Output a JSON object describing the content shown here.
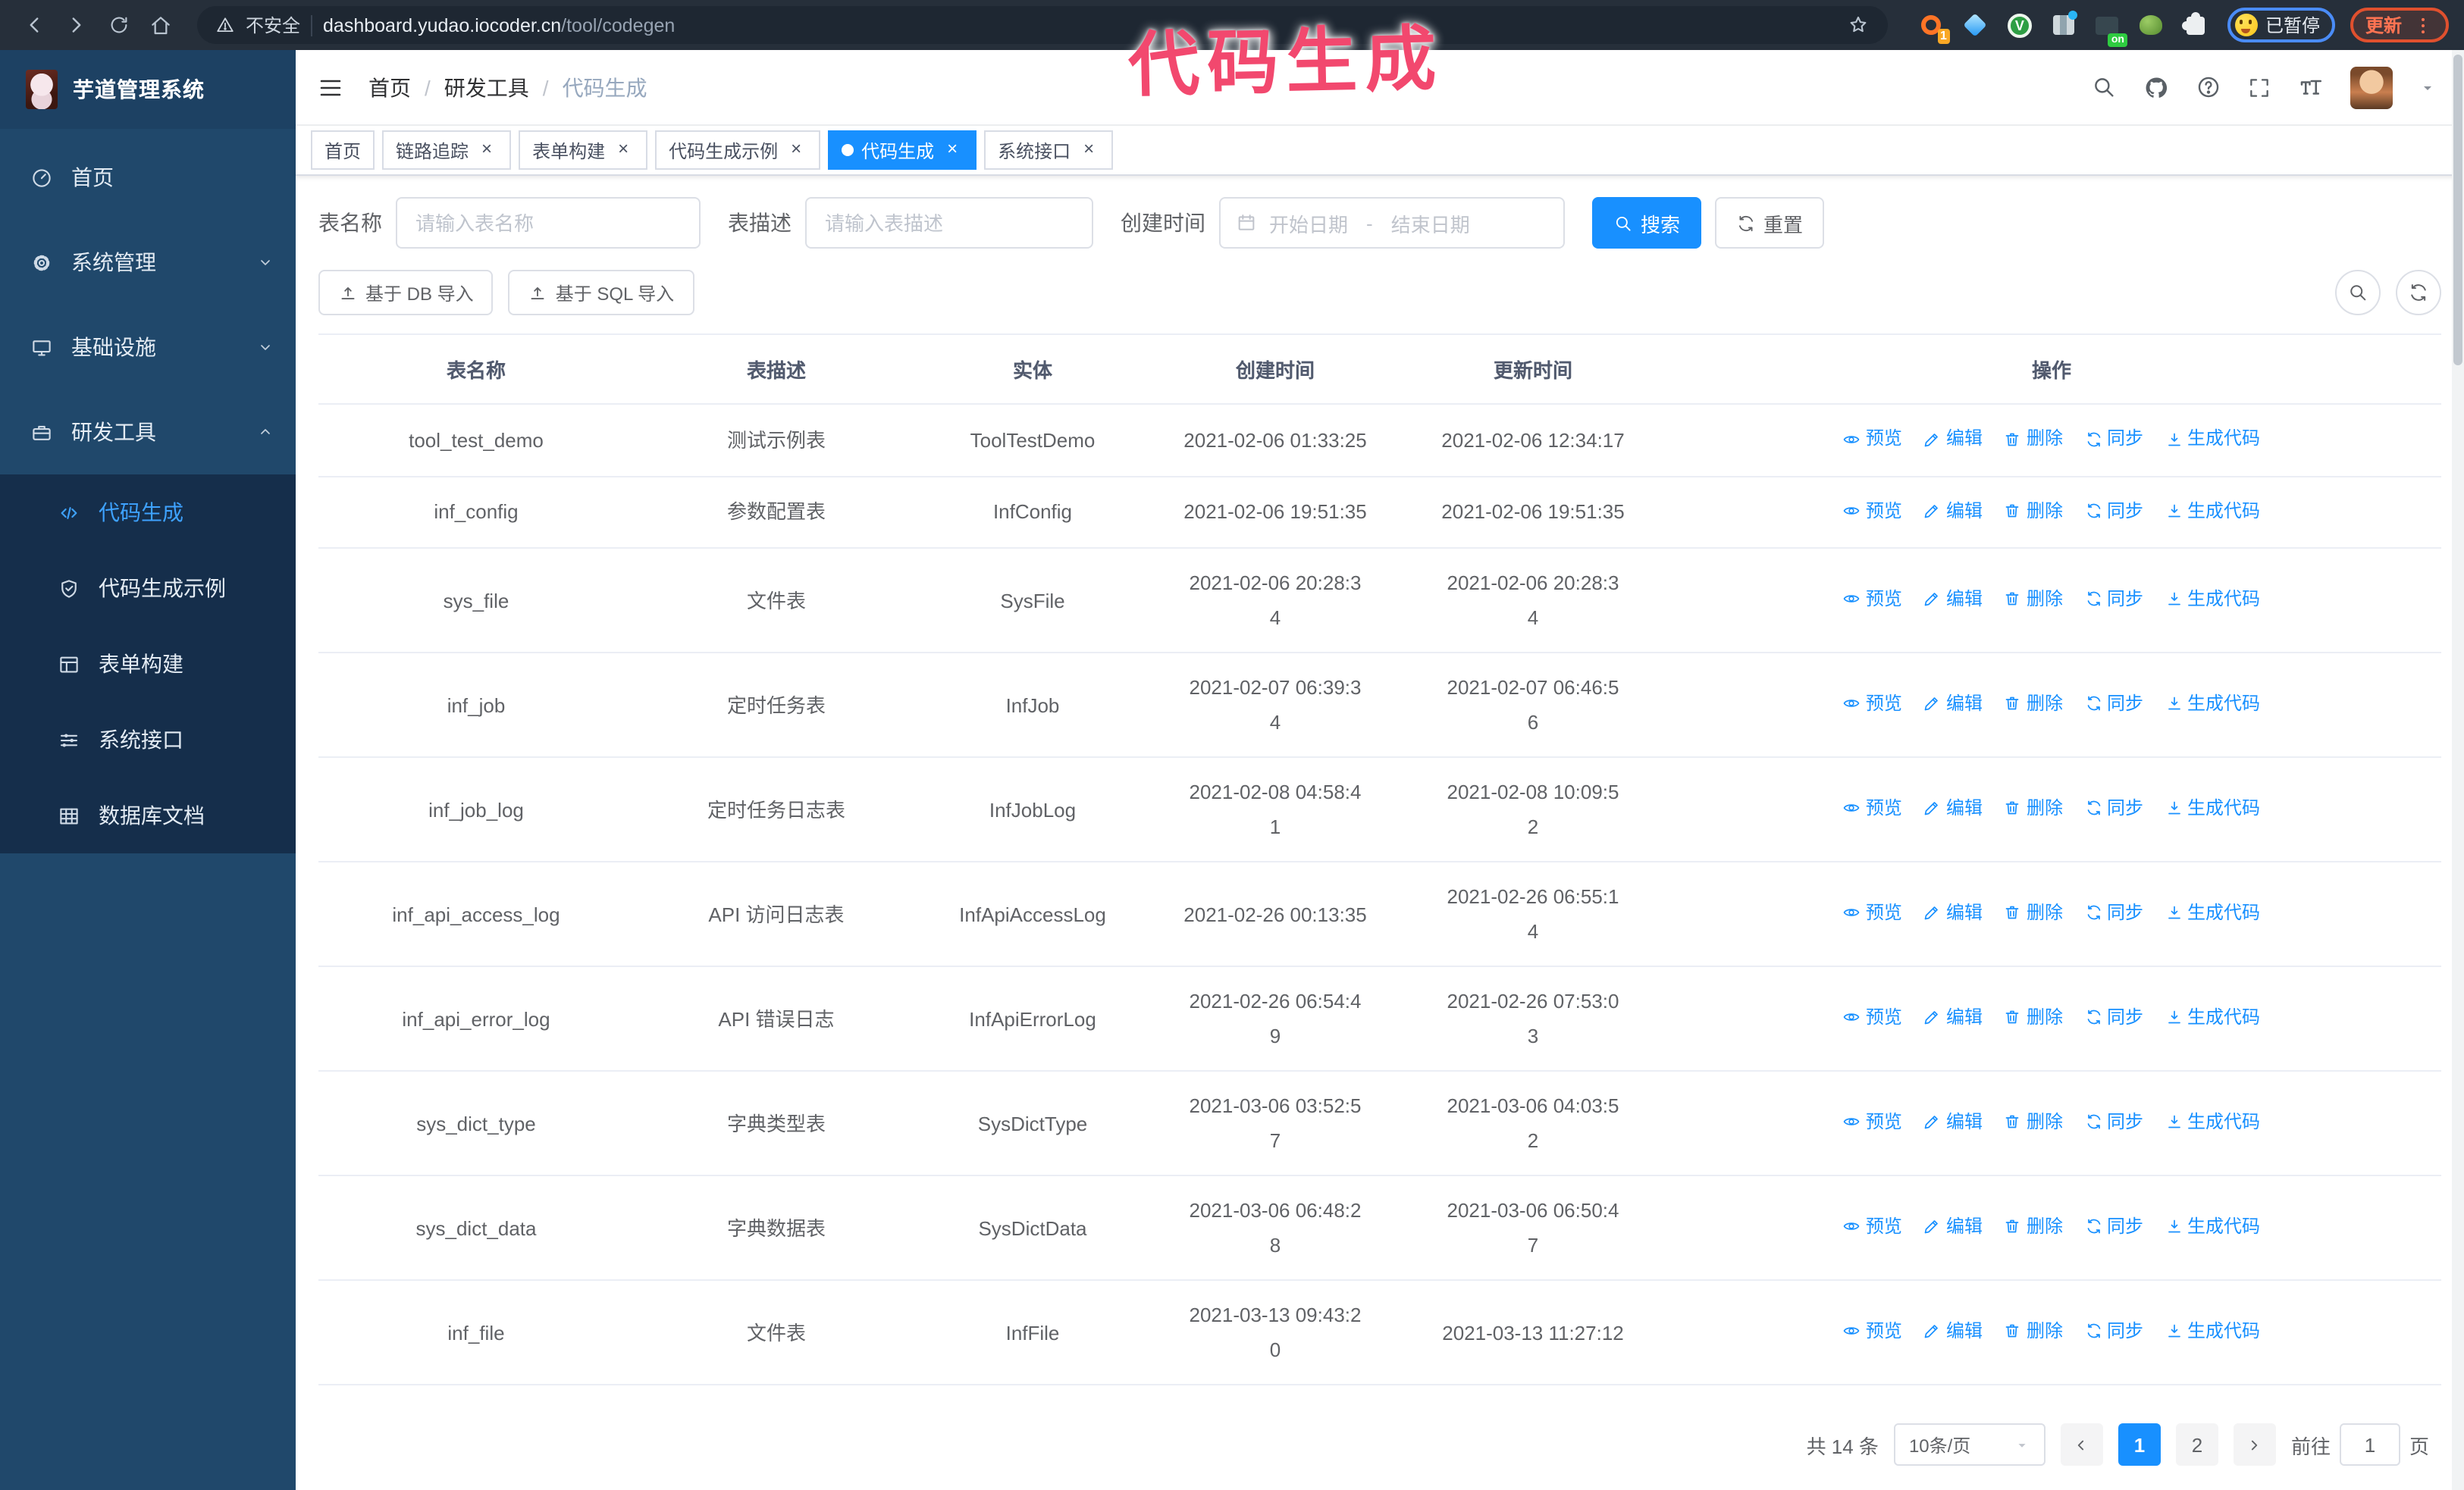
{
  "annotation": {
    "text": "代码生成",
    "color": "#f2486e"
  },
  "browser": {
    "security_label": "不安全",
    "url_host": "dashboard.yudao.iocoder.cn",
    "url_path": "/tool/codegen",
    "extension_badge": "1",
    "extension_on_badge": "on",
    "paused_label": "已暂停",
    "update_label": "更新"
  },
  "header": {
    "logo_title": "芋道管理系统",
    "breadcrumb": [
      "首页",
      "研发工具",
      "代码生成"
    ]
  },
  "tabs": [
    {
      "label": "首页",
      "closable": false,
      "active": false
    },
    {
      "label": "链路追踪",
      "closable": true,
      "active": false
    },
    {
      "label": "表单构建",
      "closable": true,
      "active": false
    },
    {
      "label": "代码生成示例",
      "closable": true,
      "active": false
    },
    {
      "label": "代码生成",
      "closable": true,
      "active": true
    },
    {
      "label": "系统接口",
      "closable": true,
      "active": false
    }
  ],
  "sidebar": {
    "items": [
      {
        "label": "首页",
        "icon": "dashboard",
        "type": "item"
      },
      {
        "label": "系统管理",
        "icon": "gear",
        "type": "group",
        "state": "collapsed"
      },
      {
        "label": "基础设施",
        "icon": "monitor",
        "type": "group",
        "state": "collapsed"
      },
      {
        "label": "研发工具",
        "icon": "toolbox",
        "type": "group",
        "state": "expanded"
      }
    ],
    "sub_items": [
      {
        "label": "代码生成",
        "icon": "code",
        "active": true
      },
      {
        "label": "代码生成示例",
        "icon": "example",
        "active": false
      },
      {
        "label": "表单构建",
        "icon": "form",
        "active": false
      },
      {
        "label": "系统接口",
        "icon": "sliders",
        "active": false
      },
      {
        "label": "数据库文档",
        "icon": "dbtable",
        "active": false
      }
    ]
  },
  "filters": {
    "table_name_label": "表名称",
    "table_name_placeholder": "请输入表名称",
    "table_desc_label": "表描述",
    "table_desc_placeholder": "请输入表描述",
    "create_time_label": "创建时间",
    "date_start_placeholder": "开始日期",
    "date_separator": "-",
    "date_end_placeholder": "结束日期",
    "search_label": "搜索",
    "reset_label": "重置"
  },
  "toolbar": {
    "import_db_label": "基于 DB 导入",
    "import_sql_label": "基于 SQL 导入"
  },
  "table": {
    "headers": [
      "表名称",
      "表描述",
      "实体",
      "创建时间",
      "更新时间",
      "操作"
    ],
    "action_labels": [
      "预览",
      "编辑",
      "删除",
      "同步",
      "生成代码"
    ],
    "rows": [
      {
        "name": "tool_test_demo",
        "desc": "测试示例表",
        "entity": "ToolTestDemo",
        "created": "2021-02-06 01:33:25",
        "updated": "2021-02-06 12:34:17"
      },
      {
        "name": "inf_config",
        "desc": "参数配置表",
        "entity": "InfConfig",
        "created": "2021-02-06 19:51:35",
        "updated": "2021-02-06 19:51:35"
      },
      {
        "name": "sys_file",
        "desc": "文件表",
        "entity": "SysFile",
        "created": "2021-02-06 20:28:3\n4",
        "updated": "2021-02-06 20:28:3\n4"
      },
      {
        "name": "inf_job",
        "desc": "定时任务表",
        "entity": "InfJob",
        "created": "2021-02-07 06:39:3\n4",
        "updated": "2021-02-07 06:46:5\n6"
      },
      {
        "name": "inf_job_log",
        "desc": "定时任务日志表",
        "entity": "InfJobLog",
        "created": "2021-02-08 04:58:4\n1",
        "updated": "2021-02-08 10:09:5\n2"
      },
      {
        "name": "inf_api_access_log",
        "desc": "API 访问日志表",
        "entity": "InfApiAccessLog",
        "created": "2021-02-26 00:13:35",
        "updated": "2021-02-26 06:55:1\n4"
      },
      {
        "name": "inf_api_error_log",
        "desc": "API 错误日志",
        "entity": "InfApiErrorLog",
        "created": "2021-02-26 06:54:4\n9",
        "updated": "2021-02-26 07:53:0\n3"
      },
      {
        "name": "sys_dict_type",
        "desc": "字典类型表",
        "entity": "SysDictType",
        "created": "2021-03-06 03:52:5\n7",
        "updated": "2021-03-06 04:03:5\n2"
      },
      {
        "name": "sys_dict_data",
        "desc": "字典数据表",
        "entity": "SysDictData",
        "created": "2021-03-06 06:48:2\n8",
        "updated": "2021-03-06 06:50:4\n7"
      },
      {
        "name": "inf_file",
        "desc": "文件表",
        "entity": "InfFile",
        "created": "2021-03-13 09:43:2\n0",
        "updated": "2021-03-13 11:27:12"
      }
    ]
  },
  "pagination": {
    "total": "共 14 条",
    "page_size": "10条/页",
    "pages": [
      "1",
      "2"
    ],
    "current_page": "1",
    "goto_label": "前往",
    "goto_value": "1",
    "page_unit": "页"
  },
  "colors": {
    "accent": "#1890ff",
    "sidebar_bg": "#20486b",
    "submenu_bg": "#152e4b",
    "annotation_pink": "#f2486e"
  }
}
